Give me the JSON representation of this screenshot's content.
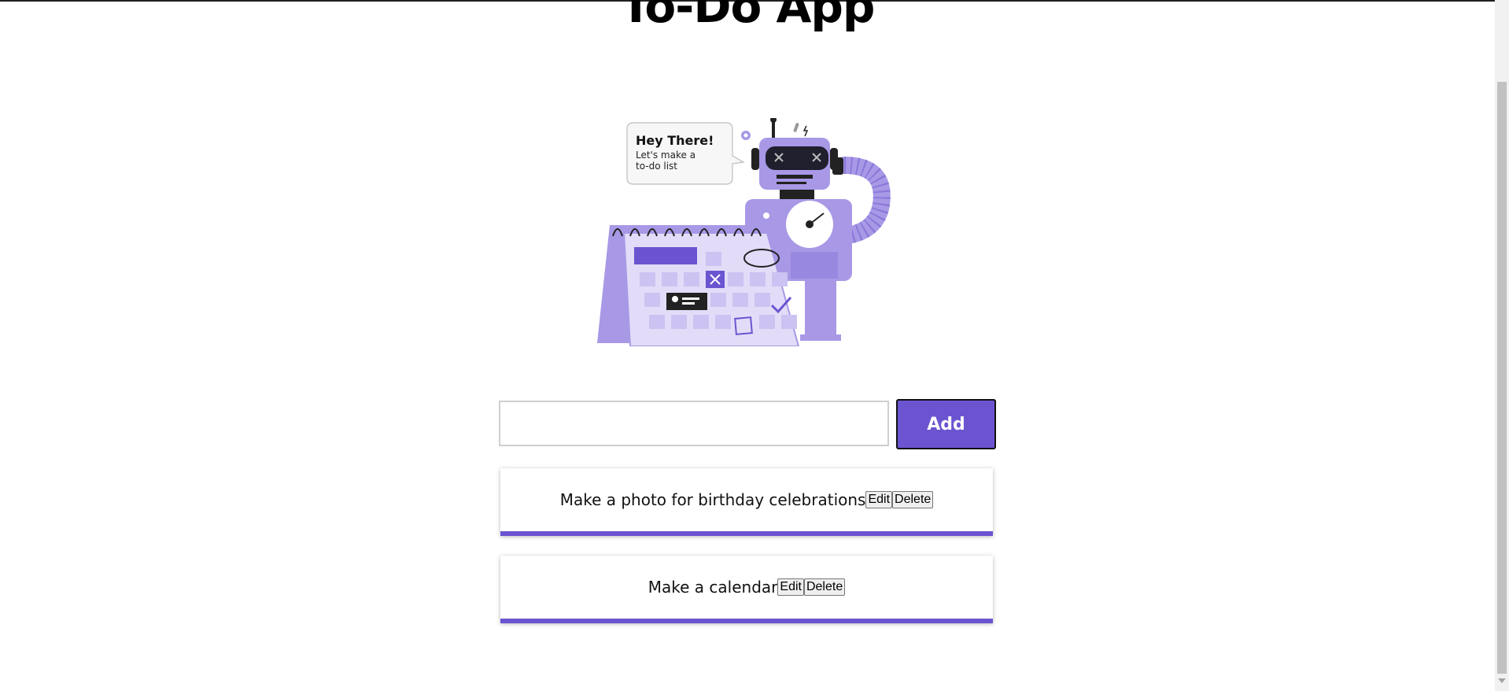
{
  "app": {
    "title": "To-Do App"
  },
  "hero": {
    "bubble_title": "Hey There!",
    "bubble_line1": "Let's make a",
    "bubble_line2": "to-do list"
  },
  "input": {
    "value": "",
    "placeholder": ""
  },
  "add_button": {
    "label": "Add"
  },
  "todos": [
    {
      "text": "Make a photo for birthday celebrations",
      "edit_label": "Edit",
      "delete_label": "Delete"
    },
    {
      "text": "Make a calendar",
      "edit_label": "Edit",
      "delete_label": "Delete"
    }
  ],
  "colors": {
    "accent": "#6c54d1",
    "illustration_light": "#ccc3f2",
    "illustration_mid": "#a898e6",
    "illustration_dark": "#222222"
  }
}
